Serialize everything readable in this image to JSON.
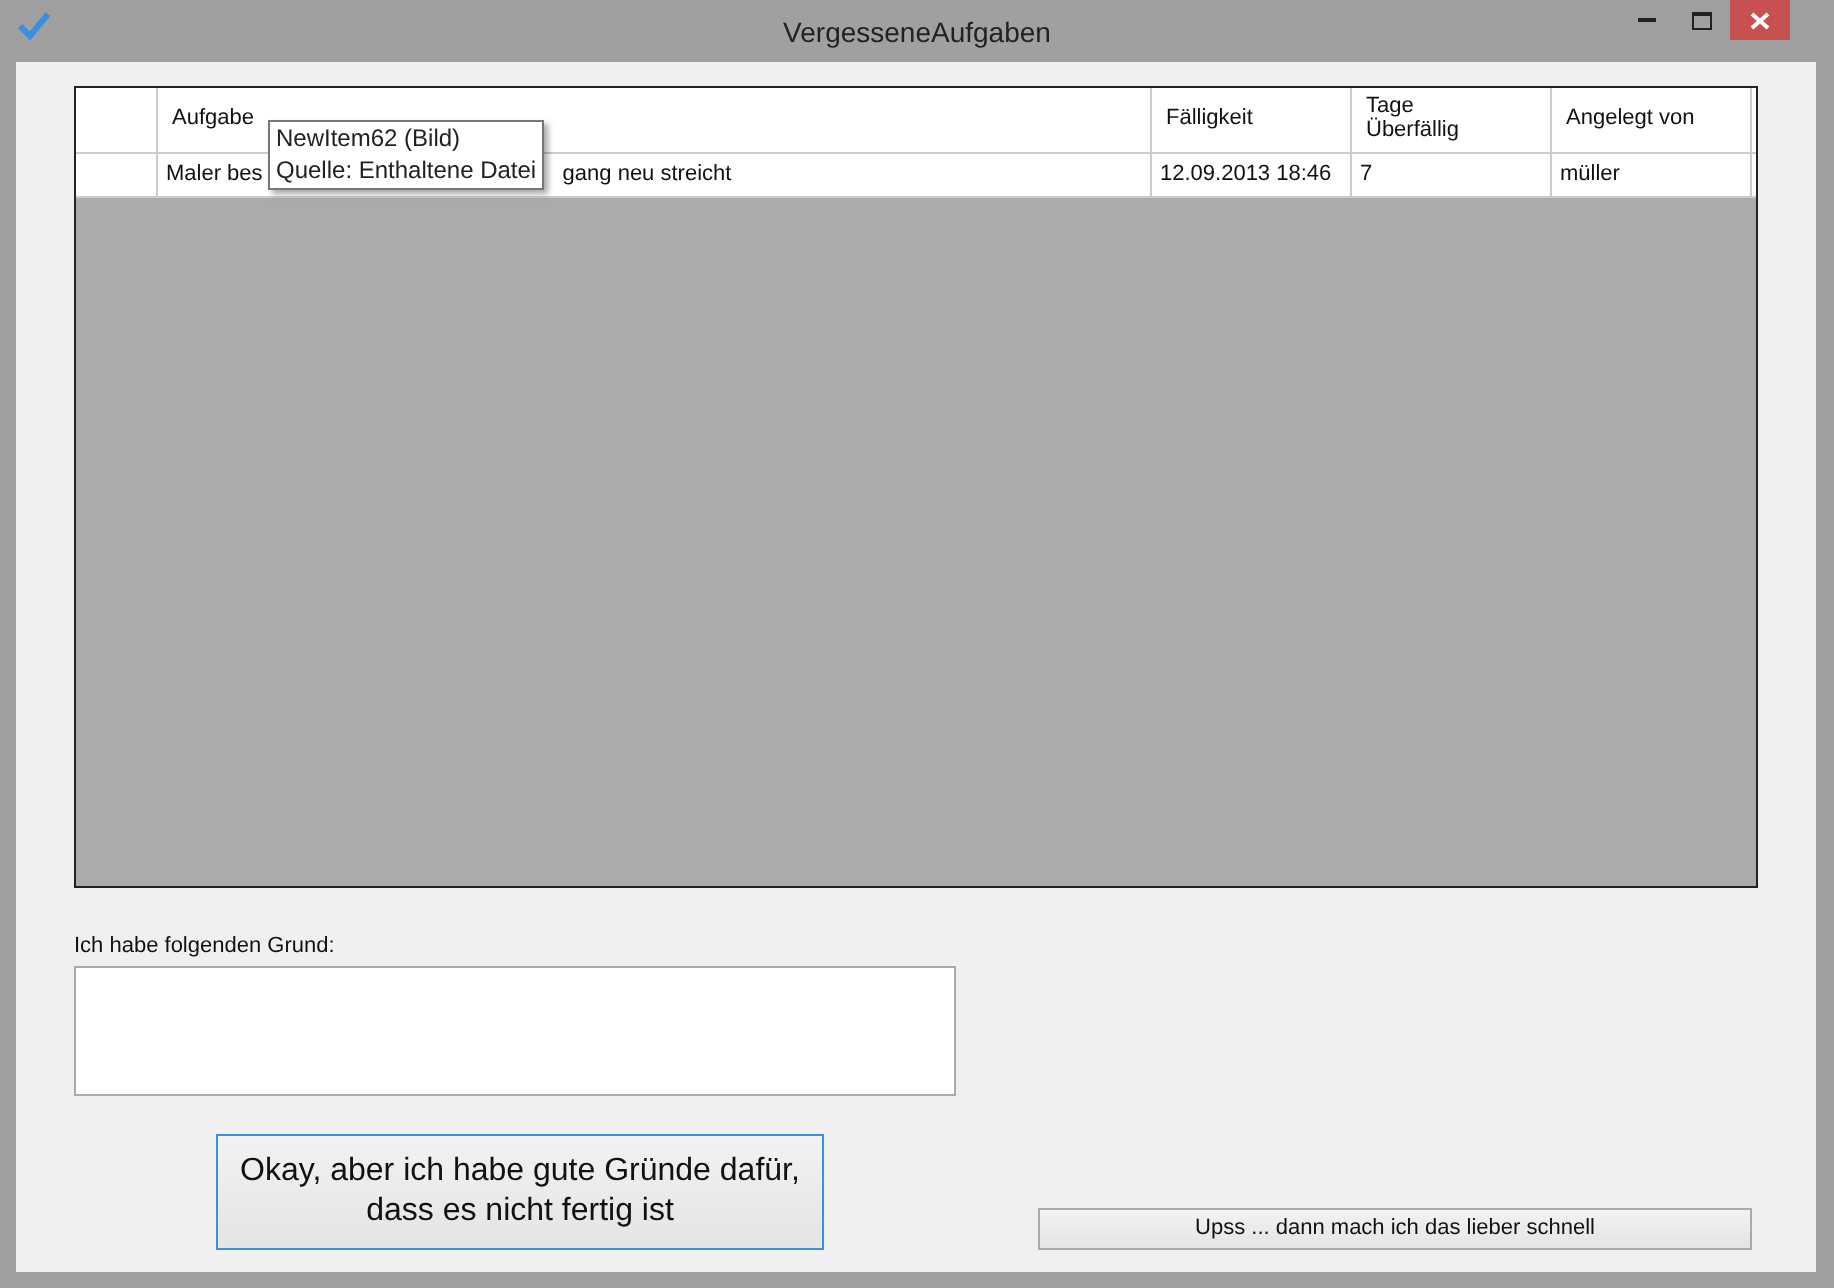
{
  "window": {
    "title": "VergesseneAufgaben"
  },
  "table": {
    "columns": [
      "Aufgabe",
      "Fälligkeit",
      "Tage\nÜberfällig",
      "Angelegt von"
    ],
    "rows": [
      {
        "cells": [
          [
            "Maler bes",
            "gang neu streicht"
          ],
          "12.09.2013 18:46",
          "7",
          "müller"
        ]
      }
    ]
  },
  "tooltip": {
    "lines": [
      "NewItem62  (Bild)",
      "Quelle: Enthaltene Datei"
    ]
  },
  "reason": {
    "label": "Ich habe folgenden Grund:"
  },
  "buttons": [
    {
      "kind": "big",
      "label": "Okay, aber ich habe gute Gründe dafür,\ndass es nicht fertig ist"
    },
    {
      "kind": "small",
      "label": "Upss ... dann mach ich das lieber schnell"
    }
  ]
}
